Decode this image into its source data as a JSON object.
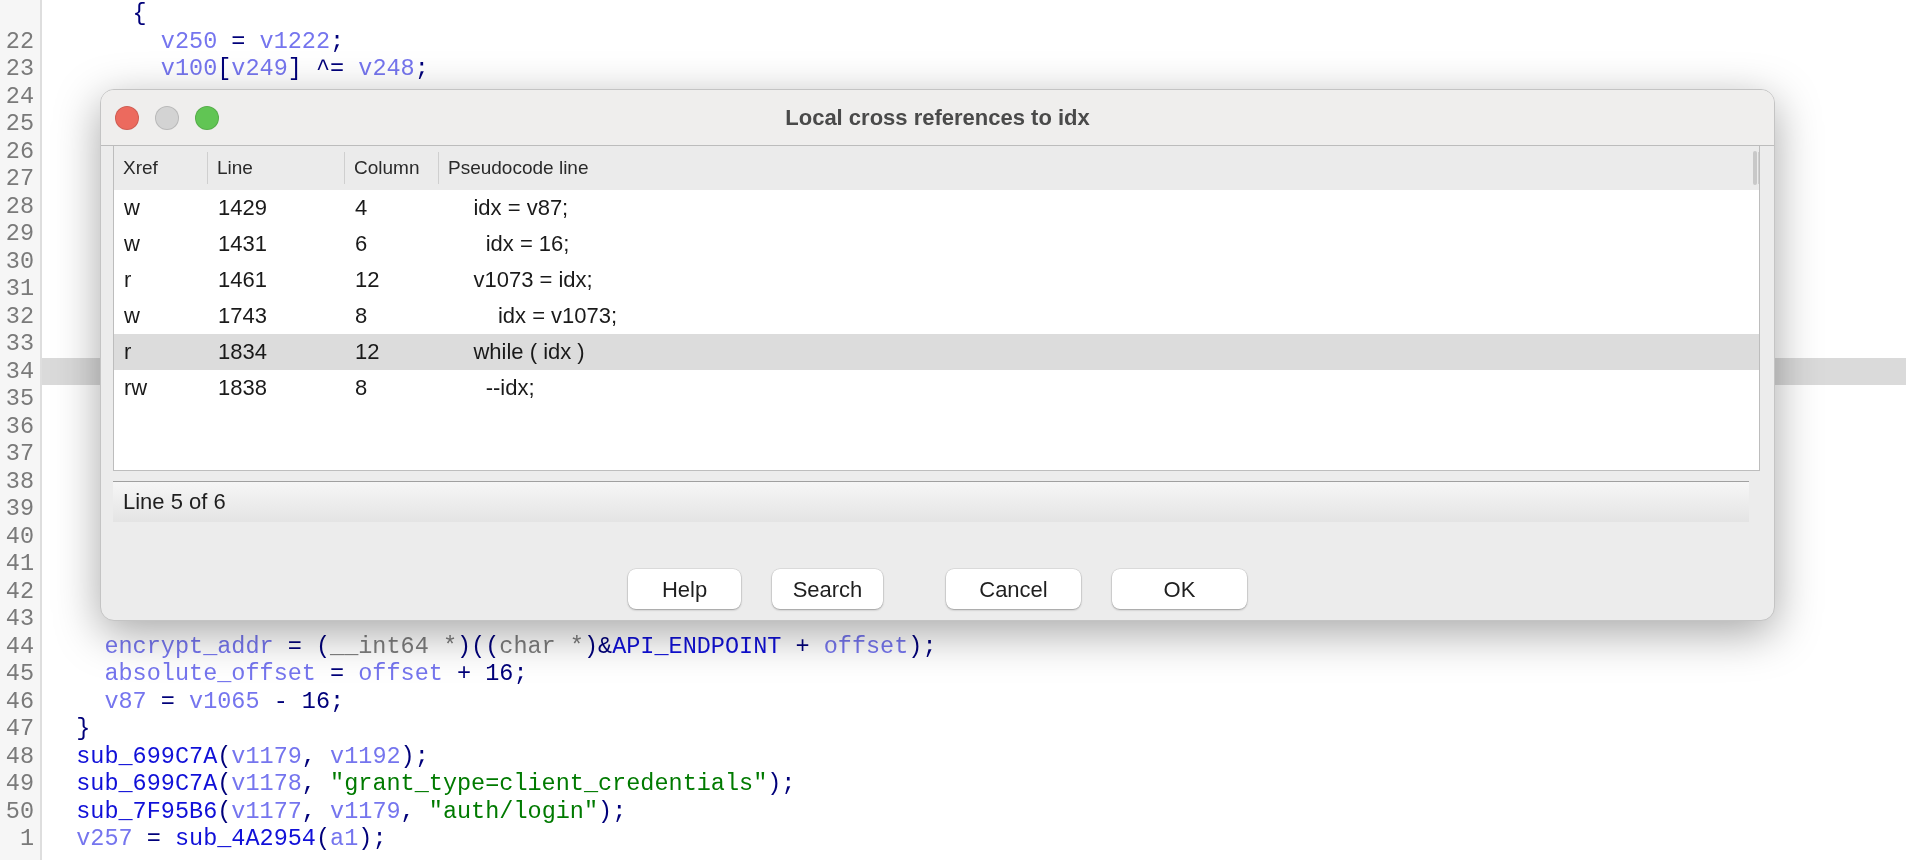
{
  "editor": {
    "lines": [
      {
        "highlighted": false,
        "tokens": [
          {
            "text": "      {",
            "kind": "punct"
          }
        ]
      },
      {
        "number": "22",
        "highlighted": false,
        "tokens": [
          {
            "text": "        v250",
            "kind": "var"
          },
          {
            "text": " = ",
            "kind": "punct"
          },
          {
            "text": "v1222",
            "kind": "var"
          },
          {
            "text": ";",
            "kind": "punct"
          }
        ]
      },
      {
        "number": "23",
        "highlighted": false,
        "tokens": [
          {
            "text": "        v100",
            "kind": "var"
          },
          {
            "text": "[",
            "kind": "punct"
          },
          {
            "text": "v249",
            "kind": "var"
          },
          {
            "text": "] ^= ",
            "kind": "punct"
          },
          {
            "text": "v248",
            "kind": "var"
          },
          {
            "text": ";",
            "kind": "punct"
          }
        ]
      },
      {
        "number": "24",
        "highlighted": false
      },
      {
        "number": "25",
        "highlighted": false
      },
      {
        "number": "26",
        "highlighted": false
      },
      {
        "number": "27",
        "highlighted": false
      },
      {
        "number": "28",
        "highlighted": false
      },
      {
        "number": "29",
        "highlighted": false
      },
      {
        "number": "30",
        "highlighted": false
      },
      {
        "number": "31",
        "highlighted": false
      },
      {
        "number": "32",
        "highlighted": false
      },
      {
        "number": "33",
        "highlighted": false
      },
      {
        "number": "34",
        "highlighted": true
      },
      {
        "number": "35",
        "highlighted": false
      },
      {
        "number": "36",
        "highlighted": false
      },
      {
        "number": "37",
        "highlighted": false
      },
      {
        "number": "38",
        "highlighted": false
      },
      {
        "number": "39",
        "highlighted": false
      },
      {
        "number": "40",
        "highlighted": false
      },
      {
        "number": "41",
        "highlighted": false
      },
      {
        "number": "42",
        "highlighted": false
      },
      {
        "number": "43",
        "highlighted": false
      },
      {
        "number": "44",
        "highlighted": false,
        "tokens": [
          {
            "text": "    encrypt_addr",
            "kind": "var"
          },
          {
            "text": " = (",
            "kind": "punct"
          },
          {
            "text": "__int64 *",
            "kind": "type"
          },
          {
            "text": ")((",
            "kind": "punct"
          },
          {
            "text": "char *",
            "kind": "type"
          },
          {
            "text": ")&",
            "kind": "punct"
          },
          {
            "text": "API_ENDPOINT",
            "kind": "func"
          },
          {
            "text": " + ",
            "kind": "punct"
          },
          {
            "text": "offset",
            "kind": "var"
          },
          {
            "text": ");",
            "kind": "punct"
          }
        ]
      },
      {
        "number": "45",
        "highlighted": false,
        "tokens": [
          {
            "text": "    absolute_offset",
            "kind": "var"
          },
          {
            "text": " = ",
            "kind": "punct"
          },
          {
            "text": "offset",
            "kind": "var"
          },
          {
            "text": " + 16;",
            "kind": "punct"
          }
        ]
      },
      {
        "number": "46",
        "highlighted": false,
        "tokens": [
          {
            "text": "    v87",
            "kind": "var"
          },
          {
            "text": " = ",
            "kind": "punct"
          },
          {
            "text": "v1065",
            "kind": "var"
          },
          {
            "text": " - 16;",
            "kind": "punct"
          }
        ]
      },
      {
        "number": "47",
        "highlighted": false,
        "tokens": [
          {
            "text": "  }",
            "kind": "punct"
          }
        ]
      },
      {
        "number": "48",
        "highlighted": false,
        "tokens": [
          {
            "text": "  sub_699C7A",
            "kind": "func"
          },
          {
            "text": "(",
            "kind": "punct"
          },
          {
            "text": "v1179",
            "kind": "var"
          },
          {
            "text": ", ",
            "kind": "punct"
          },
          {
            "text": "v1192",
            "kind": "var"
          },
          {
            "text": ");",
            "kind": "punct"
          }
        ]
      },
      {
        "number": "49",
        "highlighted": false,
        "tokens": [
          {
            "text": "  sub_699C7A",
            "kind": "func"
          },
          {
            "text": "(",
            "kind": "punct"
          },
          {
            "text": "v1178",
            "kind": "var"
          },
          {
            "text": ", ",
            "kind": "punct"
          },
          {
            "text": "\"grant_type=client_credentials\"",
            "kind": "str"
          },
          {
            "text": ");",
            "kind": "punct"
          }
        ]
      },
      {
        "number": "50",
        "highlighted": false,
        "tokens": [
          {
            "text": "  sub_7F95B6",
            "kind": "func"
          },
          {
            "text": "(",
            "kind": "punct"
          },
          {
            "text": "v1177",
            "kind": "var"
          },
          {
            "text": ", ",
            "kind": "punct"
          },
          {
            "text": "v1179",
            "kind": "var"
          },
          {
            "text": ", ",
            "kind": "punct"
          },
          {
            "text": "\"auth/login\"",
            "kind": "str"
          },
          {
            "text": ");",
            "kind": "punct"
          }
        ]
      },
      {
        "number": "1",
        "highlighted": false,
        "tokens": [
          {
            "text": "  v257",
            "kind": "var"
          },
          {
            "text": " = ",
            "kind": "punct"
          },
          {
            "text": "sub_4A2954",
            "kind": "func"
          },
          {
            "text": "(",
            "kind": "punct"
          },
          {
            "text": "a1",
            "kind": "var"
          },
          {
            "text": ");",
            "kind": "punct"
          }
        ]
      }
    ]
  },
  "dialog": {
    "title": "Local cross references to idx",
    "columns": [
      "Xref",
      "Line",
      "Column",
      "Pseudocode line"
    ],
    "rows": [
      {
        "xref": "w",
        "line": "1429",
        "column": "4",
        "code": "    idx = v87;",
        "selected": false
      },
      {
        "xref": "w",
        "line": "1431",
        "column": "6",
        "code": "      idx = 16;",
        "selected": false
      },
      {
        "xref": "r",
        "line": "1461",
        "column": "12",
        "code": "    v1073 = idx;",
        "selected": false
      },
      {
        "xref": "w",
        "line": "1743",
        "column": "8",
        "code": "        idx = v1073;",
        "selected": false
      },
      {
        "xref": "r",
        "line": "1834",
        "column": "12",
        "code": "    while ( idx )",
        "selected": true
      },
      {
        "xref": "rw",
        "line": "1838",
        "column": "8",
        "code": "      --idx;",
        "selected": false
      }
    ],
    "status": "Line 5 of 6",
    "buttons": [
      "Help",
      "Search",
      "Cancel",
      "OK"
    ]
  }
}
